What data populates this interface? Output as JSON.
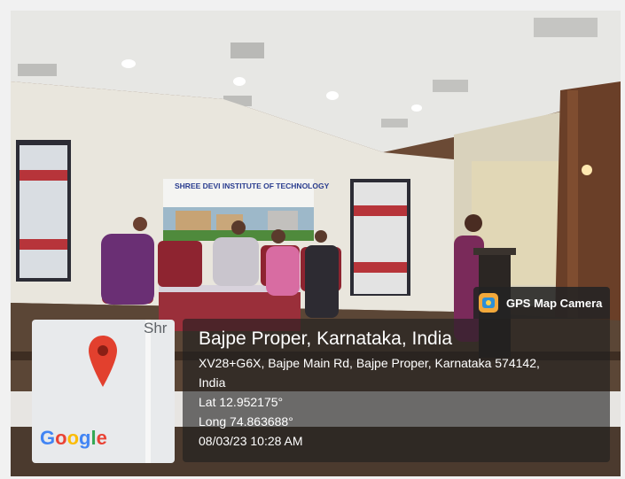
{
  "banner": {
    "institute_name": "SHREE DEVI INSTITUTE OF TECHNOLOGY"
  },
  "gps": {
    "app_name": "GPS Map Camera",
    "location_title": "Bajpe Proper, Karnataka, India",
    "address_line1": "XV28+G6X, Bajpe Main Rd, Bajpe Proper, Karnataka 574142,",
    "address_line2": "India",
    "latitude": "Lat 12.952175°",
    "longitude": "Long 74.863688°",
    "timestamp": "08/03/23 10:28 AM"
  },
  "map": {
    "street_label": "Shr",
    "logo_text": "Google",
    "pin_color": "#e2402e"
  }
}
